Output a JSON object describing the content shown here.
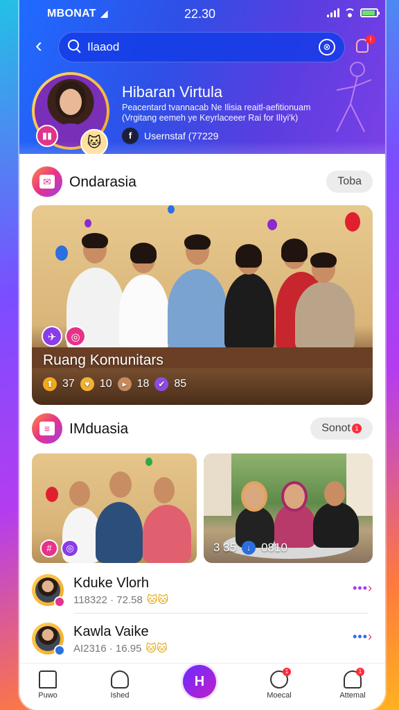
{
  "status": {
    "carrier": "MBONAT",
    "carrier_glyph": "◢",
    "time": "22.30"
  },
  "header": {
    "search_value": "Ilaaod",
    "scan_icon": "scan-icon",
    "notification_badge": "!"
  },
  "profile": {
    "title": "Hibaran Virtula",
    "subtitle_line1": "Peacentard tvannacab Ne Ilisia reaitl-aefitionuam",
    "subtitle_line2": "(Vrgitang eemeh ye Keyrlaceeer Rai for IlIyi'k)",
    "fb_letter": "f",
    "username": "Usernstaf (77229"
  },
  "section1": {
    "title": "Ondarasia",
    "action": "Toba"
  },
  "hero": {
    "title": "Ruang Komunitars",
    "stats": [
      {
        "icon": "⬆",
        "value": "37",
        "color": "#f3a91c"
      },
      {
        "icon": "♥",
        "value": "10",
        "color": "#f2b233"
      },
      {
        "icon": "▸",
        "value": "18",
        "color": "#c48a5e"
      },
      {
        "icon": "✔",
        "value": "85",
        "color": "#8a4de0"
      }
    ]
  },
  "section2": {
    "title": "IMduasia",
    "action": "Sonot",
    "action_badge": "1"
  },
  "card2": {
    "count": "3 35",
    "views": "0810"
  },
  "list": [
    {
      "name": "Kduke Vlorh",
      "meta": "118322 · 72.58"
    },
    {
      "name": "Kawla Vaike",
      "meta": "AI2316 · 16.95"
    }
  ],
  "tabs": [
    {
      "label": "Puwo"
    },
    {
      "label": "Ished"
    },
    {
      "label": "Moecal",
      "badge": "1"
    },
    {
      "label": "Attemal",
      "badge": "1"
    }
  ],
  "fab_label": "H",
  "colors": {
    "accent": "#2f5bff",
    "brand_purple": "#7b3de6",
    "pink": "#e6338a"
  }
}
